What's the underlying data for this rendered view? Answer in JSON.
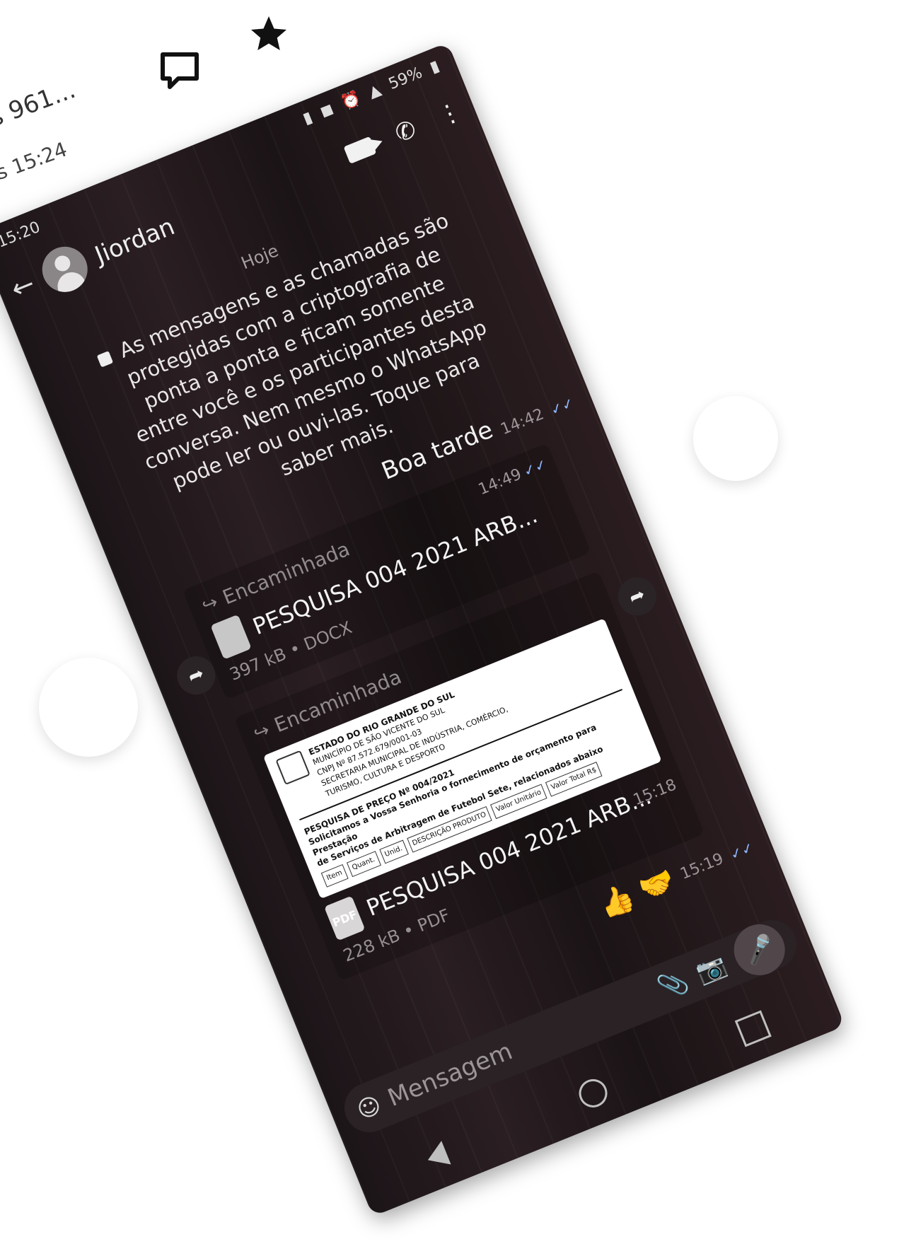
{
  "background": {
    "title": "s 961...",
    "time": "s 15:24"
  },
  "status": {
    "time": "15:20",
    "battery": "59%"
  },
  "chat": {
    "contact_name": "Jiordan",
    "date_label": "Hoje",
    "system_message": "As mensagens e as chamadas são protegidas com a criptografia de ponta a ponta e ficam somente entre você e os participantes desta conversa. Nem mesmo o WhatsApp pode ler ou ouvi-las. Toque para saber mais.",
    "messages": [
      {
        "text": "Boa tarde",
        "time": "14:42"
      }
    ],
    "document_1": {
      "forwarded": "Encaminhada",
      "name": "PESQUISA 004 2021 ARB...",
      "meta": "397 kB • DOCX",
      "time": "14:49"
    },
    "document_2": {
      "forwarded": "Encaminhada",
      "name": "PESQUISA 004 2021 ARB...",
      "meta": "228 kB • PDF",
      "time": "15:18",
      "preview": {
        "head_1": "ESTADO DO RIO GRANDE DO SUL",
        "head_2": "MUNICÍPIO DE SÃO VICENTE DO SUL",
        "head_3": "CNPJ Nº 87.572.679/0001-03",
        "head_4": "SECRETARIA MUNICIPAL DE INDÚSTRIA, COMÉRCIO,",
        "head_5": "TURISMO, CULTURA E DESPORTO",
        "title": "PESQUISA DE PREÇO Nº 004/2021",
        "body_1": "Solicitamos a Vossa Senhoria o fornecimento de orçamento para Prestação",
        "body_2": "de Serviços de Arbitragem de Futebol Sete, relacionados abaixo",
        "col_1": "Item",
        "col_2": "Quant.",
        "col_3": "Unid.",
        "col_4": "DESCRIÇÃO PRODUTO",
        "col_5": "Valor Unitário",
        "col_6": "Valor Total R$"
      }
    },
    "reaction_time": "15:19"
  },
  "composer": {
    "placeholder": "Mensagem"
  }
}
